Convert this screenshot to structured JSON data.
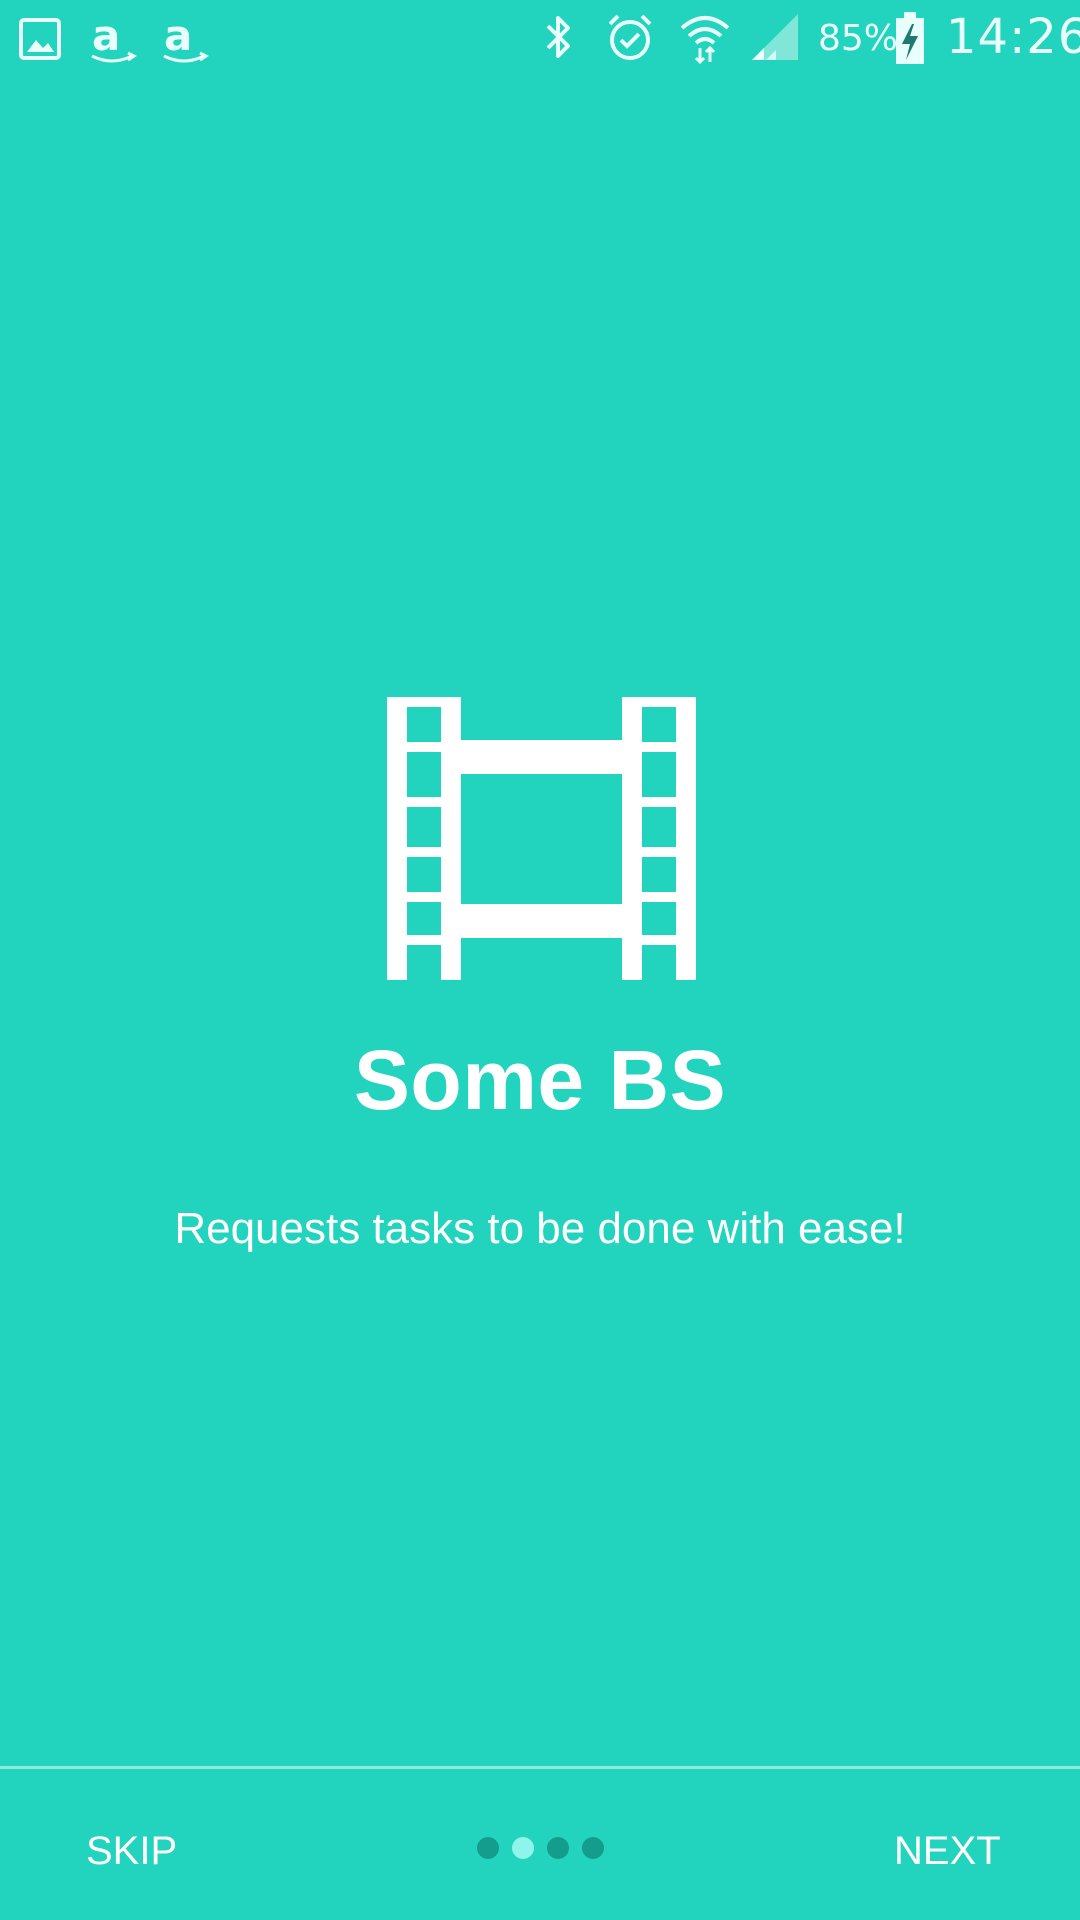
{
  "status_bar": {
    "notification_icons": [
      "gallery-icon",
      "amazon-icon",
      "amazon-icon"
    ],
    "system_icons": [
      "bluetooth-icon",
      "alarm-icon",
      "wifi-icon",
      "cell-signal-icon",
      "battery-charging-icon"
    ],
    "battery_percent": "85%",
    "time": "14:26"
  },
  "onboarding": {
    "icon": "movie-film-icon",
    "title": "Some BS",
    "description": "Requests tasks to be done with ease!"
  },
  "navigation": {
    "skip_label": "SKIP",
    "next_label": "NEXT",
    "page_count": 4,
    "current_page": 2
  },
  "colors": {
    "background": "#22D3BD",
    "text": "#FFFFFF",
    "dot_inactive": "#149C8C",
    "dot_active": "#8FF5EA",
    "divider": "#8AEBDD"
  }
}
